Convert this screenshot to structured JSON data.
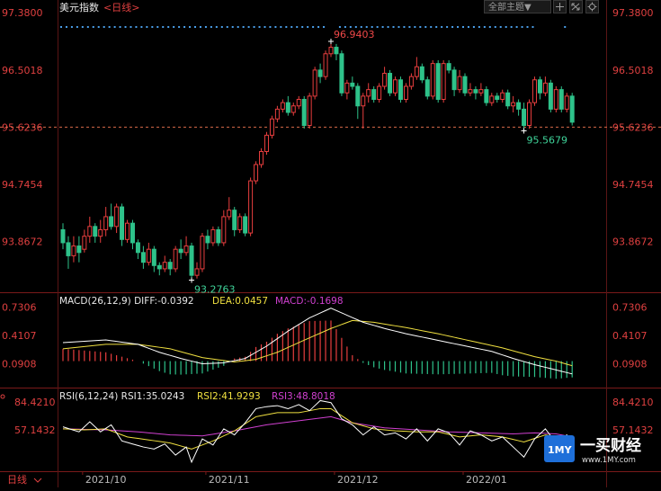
{
  "header": {
    "title": "美元指数",
    "period": "<日线>",
    "theme_label": "全部主题▼",
    "toolbar_icons": [
      "crosshair-icon",
      "expand-icon",
      "settings-icon"
    ]
  },
  "colors": {
    "up": "#e83e3e",
    "down": "#2ec28a",
    "axis_text_price": "#e04040",
    "macd_diff": "#ffffff",
    "macd_dea": "#f0e040",
    "macd_label": "#d040d0",
    "rsi1": "#ffffff",
    "rsi2": "#f0e040",
    "rsi3": "#d040d0",
    "dots": "#4a9ee8",
    "ref_line": "#d86a4a"
  },
  "chart_data": [
    {
      "type": "candlestick",
      "title": "美元指数<日线>",
      "y_ticks": [
        "97.3800",
        "96.5018",
        "95.6236",
        "94.7454",
        "93.8672"
      ],
      "y_tick_values": [
        97.38,
        96.5018,
        95.6236,
        94.7454,
        93.8672
      ],
      "ylim": [
        93.09,
        97.575
      ],
      "annotations": [
        {
          "label": "96.9403",
          "value": 96.9403,
          "index": 50,
          "kind": "high"
        },
        {
          "label": "93.2763",
          "value": 93.2763,
          "index": 24,
          "kind": "low"
        },
        {
          "label": "95.5679",
          "value": 95.5679,
          "index": 86,
          "kind": "recent-low"
        }
      ],
      "reference_line": {
        "label": "95.6236",
        "value": 95.6236
      },
      "x_ticks": [
        {
          "label": "2021/10",
          "index": 4
        },
        {
          "label": "2021/11",
          "index": 27
        },
        {
          "label": "2021/12",
          "index": 51
        },
        {
          "label": "2022/01",
          "index": 75
        }
      ],
      "candles": [
        [
          94.05,
          93.85,
          94.15,
          93.75
        ],
        [
          93.85,
          93.65,
          93.95,
          93.45
        ],
        [
          93.65,
          93.8,
          93.95,
          93.55
        ],
        [
          93.8,
          93.7,
          93.95,
          93.55
        ],
        [
          93.75,
          93.95,
          94.05,
          93.7
        ],
        [
          93.95,
          94.1,
          94.25,
          93.85
        ],
        [
          94.1,
          93.95,
          94.15,
          93.85
        ],
        [
          93.95,
          94.05,
          94.2,
          93.85
        ],
        [
          94.05,
          94.25,
          94.4,
          93.95
        ],
        [
          94.25,
          94.1,
          94.45,
          94.05
        ],
        [
          94.1,
          94.4,
          94.45,
          94.0
        ],
        [
          94.4,
          93.9,
          94.45,
          93.8
        ],
        [
          93.9,
          94.15,
          94.2,
          93.85
        ],
        [
          94.15,
          93.85,
          94.2,
          93.75
        ],
        [
          93.85,
          93.7,
          93.9,
          93.6
        ],
        [
          93.7,
          93.55,
          93.8,
          93.45
        ],
        [
          93.55,
          93.75,
          93.85,
          93.5
        ],
        [
          93.75,
          93.5,
          93.8,
          93.4
        ],
        [
          93.5,
          93.45,
          93.55,
          93.35
        ],
        [
          93.45,
          93.55,
          93.65,
          93.4
        ],
        [
          93.55,
          93.45,
          93.6,
          93.35
        ],
        [
          93.45,
          93.75,
          93.8,
          93.4
        ],
        [
          93.75,
          93.7,
          93.9,
          93.6
        ],
        [
          93.7,
          93.8,
          93.95,
          93.65
        ],
        [
          93.8,
          93.35,
          93.85,
          93.28
        ],
        [
          93.35,
          93.45,
          93.55,
          93.3
        ],
        [
          93.45,
          93.95,
          94.0,
          93.4
        ],
        [
          93.95,
          93.85,
          94.05,
          93.75
        ],
        [
          93.85,
          94.05,
          94.1,
          93.8
        ],
        [
          94.05,
          93.85,
          94.1,
          93.8
        ],
        [
          93.85,
          94.25,
          94.35,
          93.8
        ],
        [
          94.25,
          94.35,
          94.55,
          94.2
        ],
        [
          94.35,
          94.05,
          94.4,
          93.95
        ],
        [
          94.05,
          94.25,
          94.3,
          94.0
        ],
        [
          94.25,
          94.0,
          94.3,
          93.95
        ],
        [
          94.0,
          94.8,
          94.85,
          93.95
        ],
        [
          94.8,
          95.05,
          95.1,
          94.75
        ],
        [
          95.05,
          95.25,
          95.3,
          95.0
        ],
        [
          95.25,
          95.5,
          95.55,
          95.2
        ],
        [
          95.5,
          95.75,
          95.8,
          95.45
        ],
        [
          95.75,
          95.9,
          95.95,
          95.7
        ],
        [
          95.9,
          96.0,
          96.05,
          95.85
        ],
        [
          96.0,
          95.85,
          96.1,
          95.8
        ],
        [
          95.85,
          95.95,
          96.0,
          95.8
        ],
        [
          95.95,
          96.05,
          96.1,
          95.9
        ],
        [
          96.05,
          95.65,
          96.1,
          95.6
        ],
        [
          95.65,
          96.1,
          96.15,
          95.6
        ],
        [
          96.1,
          96.5,
          96.55,
          96.05
        ],
        [
          96.5,
          96.4,
          96.6,
          96.3
        ],
        [
          96.4,
          96.75,
          96.8,
          96.35
        ],
        [
          96.75,
          96.85,
          96.94,
          96.7
        ],
        [
          96.85,
          96.75,
          96.9,
          96.65
        ],
        [
          96.75,
          96.15,
          96.8,
          96.1
        ],
        [
          96.15,
          96.3,
          96.35,
          96.05
        ],
        [
          96.3,
          96.25,
          96.4,
          96.2
        ],
        [
          96.25,
          95.95,
          96.3,
          95.75
        ],
        [
          95.95,
          96.1,
          96.15,
          95.6
        ],
        [
          96.1,
          96.2,
          96.3,
          96.0
        ],
        [
          96.2,
          96.05,
          96.25,
          96.0
        ],
        [
          96.05,
          96.25,
          96.3,
          96.0
        ],
        [
          96.25,
          96.45,
          96.55,
          96.2
        ],
        [
          96.45,
          96.15,
          96.5,
          96.1
        ],
        [
          96.15,
          96.35,
          96.4,
          96.1
        ],
        [
          96.35,
          96.05,
          96.4,
          96.0
        ],
        [
          96.05,
          96.25,
          96.3,
          96.0
        ],
        [
          96.25,
          96.4,
          96.45,
          96.2
        ],
        [
          96.4,
          96.55,
          96.7,
          96.35
        ],
        [
          96.55,
          96.35,
          96.6,
          96.3
        ],
        [
          96.35,
          96.1,
          96.4,
          96.05
        ],
        [
          96.1,
          96.6,
          96.65,
          96.05
        ],
        [
          96.6,
          96.05,
          96.65,
          96.0
        ],
        [
          96.05,
          96.6,
          96.65,
          96.0
        ],
        [
          96.6,
          96.5,
          96.65,
          96.45
        ],
        [
          96.5,
          96.2,
          96.55,
          96.1
        ],
        [
          96.2,
          96.4,
          96.5,
          96.15
        ],
        [
          96.4,
          96.15,
          96.45,
          96.1
        ],
        [
          96.15,
          96.2,
          96.3,
          96.1
        ],
        [
          96.2,
          96.15,
          96.25,
          96.05
        ],
        [
          96.15,
          96.2,
          96.3,
          96.1
        ],
        [
          96.2,
          96.0,
          96.25,
          95.95
        ],
        [
          96.0,
          96.1,
          96.15,
          95.95
        ],
        [
          96.1,
          96.05,
          96.15,
          96.0
        ],
        [
          96.05,
          96.15,
          96.2,
          96.0
        ],
        [
          96.15,
          95.95,
          96.2,
          95.9
        ],
        [
          95.95,
          96.0,
          96.1,
          95.85
        ],
        [
          96.0,
          95.9,
          96.05,
          95.8
        ],
        [
          95.9,
          95.65,
          96.0,
          95.57
        ],
        [
          95.65,
          96.0,
          96.05,
          95.6
        ],
        [
          96.0,
          96.35,
          96.4,
          95.95
        ],
        [
          96.35,
          96.15,
          96.4,
          96.05
        ],
        [
          96.15,
          96.3,
          96.4,
          96.1
        ],
        [
          96.3,
          95.9,
          96.35,
          95.85
        ],
        [
          95.9,
          96.2,
          96.25,
          95.85
        ],
        [
          96.2,
          95.9,
          96.25,
          95.85
        ],
        [
          95.9,
          96.1,
          96.15,
          95.85
        ],
        [
          96.1,
          95.7,
          96.15,
          95.65
        ]
      ]
    },
    {
      "type": "line",
      "title": "MACD(26,12,9)",
      "readouts": {
        "diff": "DIFF:-0.0392",
        "dea": "DEA:0.0457",
        "macd": "MACD:-0.1698"
      },
      "y_ticks": [
        "0.7306",
        "0.4107",
        "0.0908"
      ],
      "y_tick_values": [
        0.7306,
        0.4107,
        0.0908
      ],
      "ylim": [
        -0.18,
        0.89
      ],
      "diff_anchors": [
        [
          0,
          0.33
        ],
        [
          8,
          0.36
        ],
        [
          14,
          0.31
        ],
        [
          18,
          0.22
        ],
        [
          22,
          0.15
        ],
        [
          26,
          0.09
        ],
        [
          30,
          0.1
        ],
        [
          34,
          0.15
        ],
        [
          38,
          0.29
        ],
        [
          42,
          0.46
        ],
        [
          46,
          0.61
        ],
        [
          50,
          0.72
        ],
        [
          53,
          0.64
        ],
        [
          56,
          0.56
        ],
        [
          60,
          0.49
        ],
        [
          64,
          0.43
        ],
        [
          68,
          0.38
        ],
        [
          72,
          0.33
        ],
        [
          76,
          0.28
        ],
        [
          80,
          0.23
        ],
        [
          84,
          0.15
        ],
        [
          88,
          0.08
        ],
        [
          92,
          0.02
        ],
        [
          96,
          -0.04
        ]
      ],
      "dea_anchors": [
        [
          0,
          0.26
        ],
        [
          8,
          0.31
        ],
        [
          14,
          0.31
        ],
        [
          20,
          0.26
        ],
        [
          26,
          0.16
        ],
        [
          32,
          0.11
        ],
        [
          36,
          0.14
        ],
        [
          40,
          0.22
        ],
        [
          44,
          0.33
        ],
        [
          50,
          0.49
        ],
        [
          54,
          0.58
        ],
        [
          58,
          0.56
        ],
        [
          64,
          0.5
        ],
        [
          70,
          0.43
        ],
        [
          76,
          0.35
        ],
        [
          82,
          0.27
        ],
        [
          88,
          0.17
        ],
        [
          92,
          0.12
        ],
        [
          96,
          0.05
        ]
      ]
    },
    {
      "type": "line",
      "title": "RSI(6,12,24)",
      "readouts": {
        "rsi1": "RSI1:35.0243",
        "rsi2": "RSI2:41.9293",
        "rsi3": "RSI3:48.8018"
      },
      "y_ticks": [
        "84.4210",
        "57.1432"
      ],
      "y_tick_values": [
        84.421,
        57.1432
      ],
      "ylim": [
        16.0,
        98.0
      ],
      "rsi1_anchors": [
        [
          0,
          60
        ],
        [
          3,
          55
        ],
        [
          5,
          65
        ],
        [
          7,
          55
        ],
        [
          9,
          62
        ],
        [
          11,
          46
        ],
        [
          13,
          43
        ],
        [
          15,
          40
        ],
        [
          17,
          38
        ],
        [
          19,
          43
        ],
        [
          21,
          32
        ],
        [
          23,
          40
        ],
        [
          24,
          25
        ],
        [
          26,
          48
        ],
        [
          28,
          42
        ],
        [
          30,
          58
        ],
        [
          32,
          52
        ],
        [
          34,
          64
        ],
        [
          36,
          78
        ],
        [
          38,
          80
        ],
        [
          40,
          81
        ],
        [
          42,
          78
        ],
        [
          44,
          82
        ],
        [
          46,
          76
        ],
        [
          48,
          86
        ],
        [
          50,
          84
        ],
        [
          52,
          68
        ],
        [
          54,
          62
        ],
        [
          56,
          52
        ],
        [
          58,
          60
        ],
        [
          60,
          52
        ],
        [
          62,
          54
        ],
        [
          64,
          48
        ],
        [
          66,
          58
        ],
        [
          68,
          46
        ],
        [
          70,
          58
        ],
        [
          72,
          54
        ],
        [
          74,
          42
        ],
        [
          76,
          56
        ],
        [
          78,
          52
        ],
        [
          80,
          46
        ],
        [
          82,
          50
        ],
        [
          84,
          40
        ],
        [
          86,
          30
        ],
        [
          88,
          48
        ],
        [
          90,
          58
        ],
        [
          92,
          44
        ],
        [
          94,
          52
        ],
        [
          96,
          35
        ]
      ],
      "rsi2_anchors": [
        [
          0,
          58
        ],
        [
          4,
          57
        ],
        [
          8,
          58
        ],
        [
          12,
          50
        ],
        [
          16,
          47
        ],
        [
          20,
          44
        ],
        [
          24,
          38
        ],
        [
          28,
          46
        ],
        [
          32,
          56
        ],
        [
          36,
          70
        ],
        [
          40,
          74
        ],
        [
          44,
          74
        ],
        [
          48,
          78
        ],
        [
          50,
          78
        ],
        [
          54,
          64
        ],
        [
          58,
          58
        ],
        [
          62,
          56
        ],
        [
          66,
          55
        ],
        [
          70,
          55
        ],
        [
          74,
          50
        ],
        [
          78,
          52
        ],
        [
          82,
          50
        ],
        [
          86,
          45
        ],
        [
          90,
          52
        ],
        [
          94,
          48
        ],
        [
          96,
          42
        ]
      ],
      "rsi3_anchors": [
        [
          0,
          58
        ],
        [
          8,
          57
        ],
        [
          14,
          55
        ],
        [
          20,
          52
        ],
        [
          26,
          51
        ],
        [
          32,
          56
        ],
        [
          38,
          62
        ],
        [
          44,
          66
        ],
        [
          50,
          70
        ],
        [
          54,
          64
        ],
        [
          60,
          59
        ],
        [
          66,
          57
        ],
        [
          72,
          55
        ],
        [
          78,
          54
        ],
        [
          84,
          53
        ],
        [
          88,
          54
        ],
        [
          92,
          53
        ],
        [
          96,
          49
        ]
      ]
    }
  ],
  "footer": {
    "period_button": "日线"
  },
  "brand": {
    "badge": "1MY",
    "name": "一买财经",
    "url": "www.1MY.com"
  }
}
